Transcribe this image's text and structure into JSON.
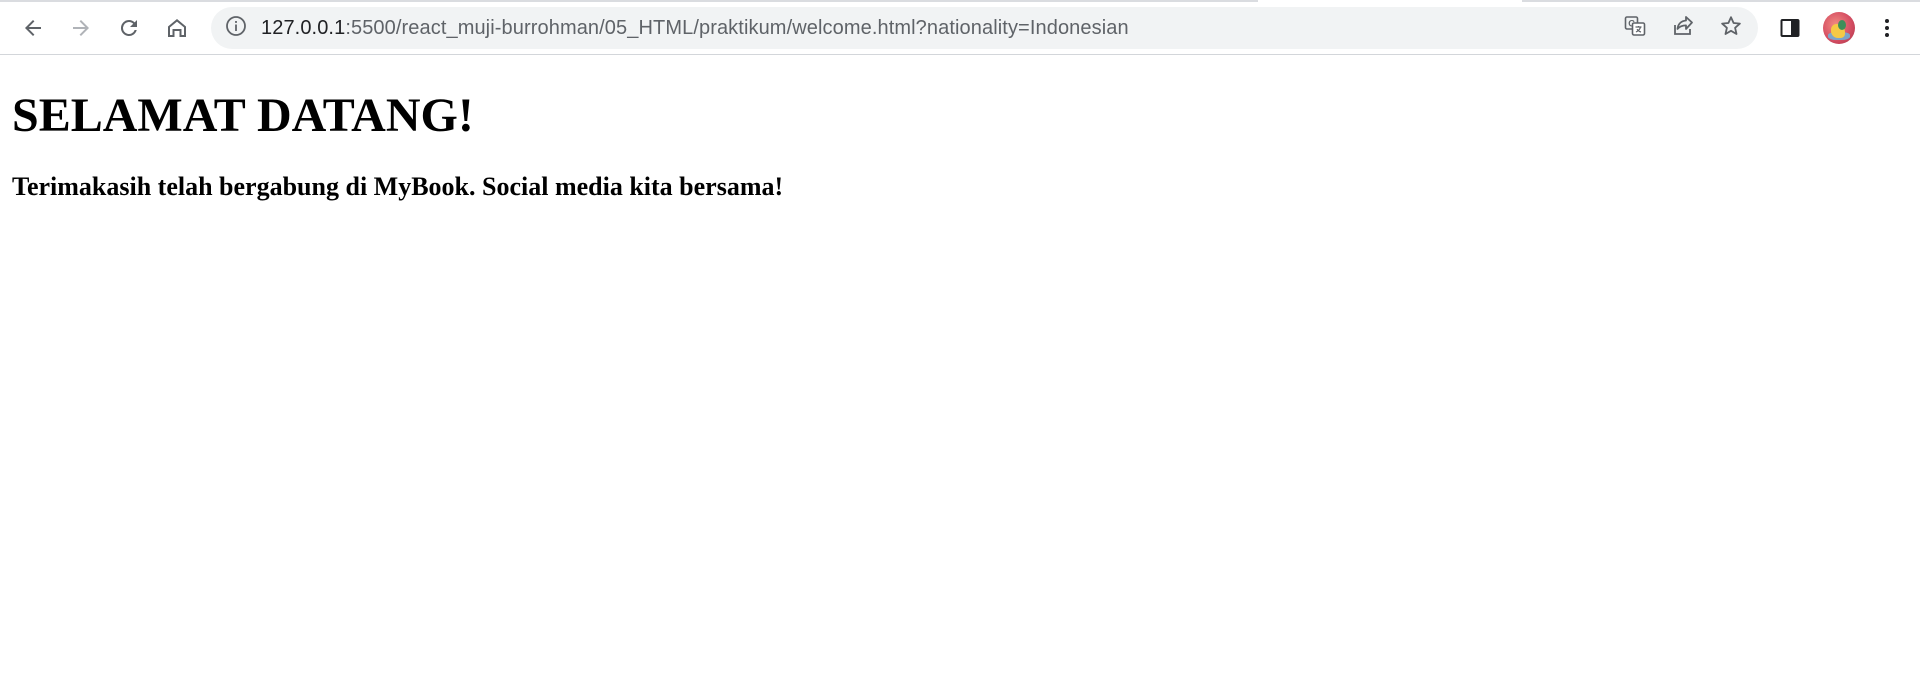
{
  "browser": {
    "url": {
      "host": "127.0.0.1",
      "rest": ":5500/react_muji-burrohman/05_HTML/praktikum/welcome.html?nationality=Indonesian"
    },
    "icons": {
      "back": "arrow-left-icon",
      "forward": "arrow-right-icon",
      "reload": "reload-icon",
      "home": "home-icon",
      "site_info": "info-icon",
      "translate": "translate-icon",
      "share": "share-icon",
      "bookmark": "star-icon",
      "side_panel": "side-panel-icon",
      "menu": "kebab-menu-icon"
    }
  },
  "page": {
    "heading": "SELAMAT DATANG!",
    "subheading": "Terimakasih telah bergabung di MyBook. Social media kita bersama!"
  }
}
